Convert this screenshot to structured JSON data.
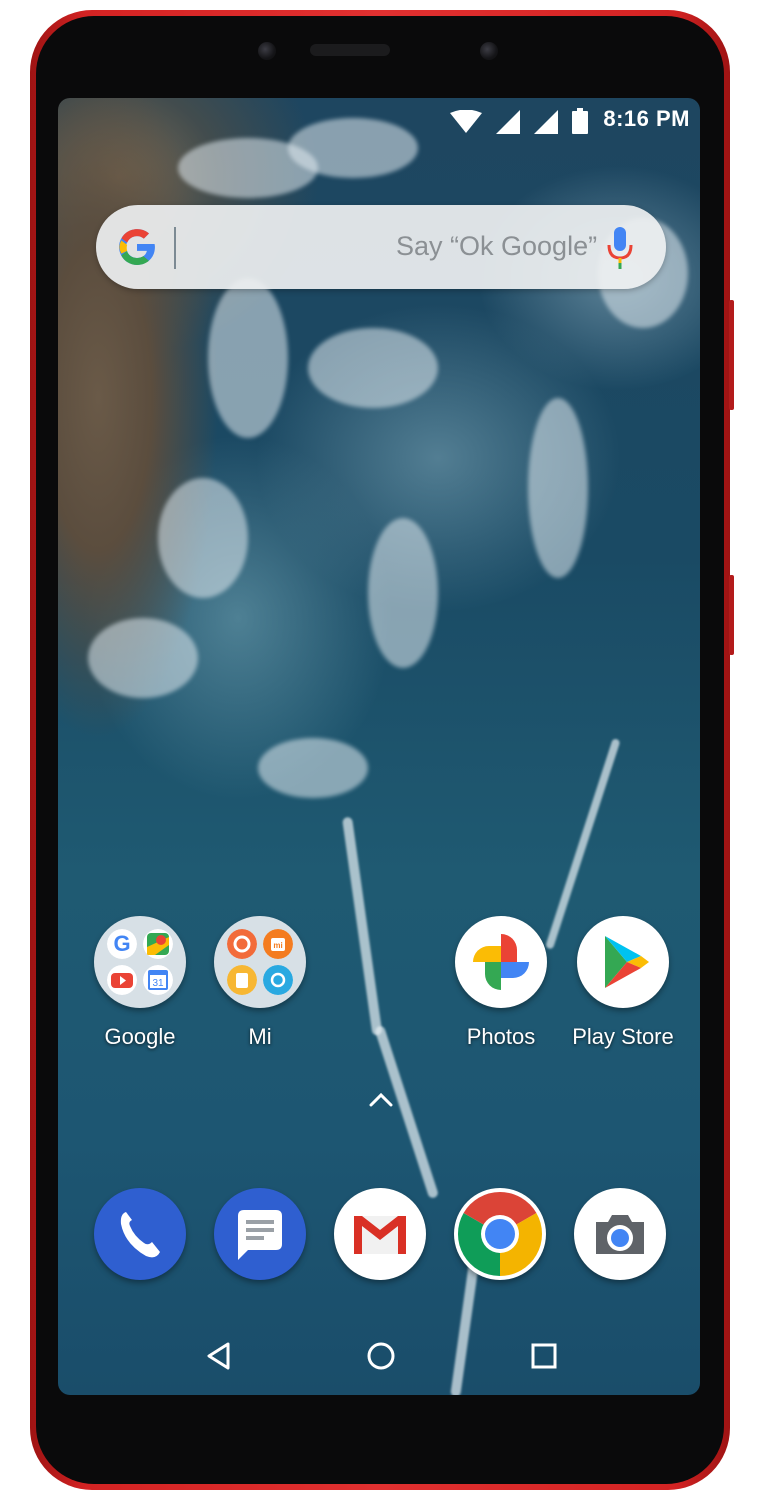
{
  "status_bar": {
    "time": "8:16 PM",
    "icons": [
      "wifi-icon",
      "signal-icon",
      "signal-icon",
      "battery-icon"
    ]
  },
  "search": {
    "placeholder": "Say “Ok Google”",
    "logo_icon": "google-g-icon",
    "mic_icon": "mic-icon"
  },
  "home_apps": [
    {
      "label": "Google",
      "icon": "google-folder-icon"
    },
    {
      "label": "Mi",
      "icon": "mi-folder-icon"
    },
    {
      "label": "Photos",
      "icon": "photos-icon"
    },
    {
      "label": "Play Store",
      "icon": "play-store-icon"
    }
  ],
  "drawer_icon": "chevron-up-icon",
  "dock": [
    {
      "icon": "phone-icon",
      "color": "#2f5fd0"
    },
    {
      "icon": "messages-icon",
      "color": "#2f5fd0"
    },
    {
      "icon": "gmail-icon",
      "color": "#ffffff"
    },
    {
      "icon": "chrome-icon",
      "color": "#ffffff"
    },
    {
      "icon": "camera-icon",
      "color": "#ffffff"
    }
  ],
  "nav": [
    "back-icon",
    "home-icon",
    "recents-icon"
  ],
  "colors": {
    "phone_body": "#e13030",
    "google_blue": "#4285F4",
    "google_red": "#EA4335",
    "google_yellow": "#FBBC05",
    "google_green": "#34A853"
  }
}
